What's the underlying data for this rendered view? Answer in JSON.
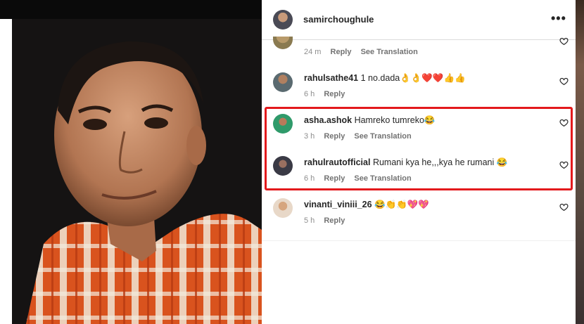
{
  "post": {
    "author": "samirchoughule",
    "more_label": "•••"
  },
  "partial_comment": {
    "time": "24 m",
    "reply_label": "Reply",
    "translate_label": "See Translation"
  },
  "comments": [
    {
      "username": "rahulsathe41",
      "text": "1 no.dada👌👌❤️❤️👍👍",
      "time": "6 h",
      "reply_label": "Reply",
      "translate_label": ""
    },
    {
      "username": "asha.ashok",
      "text": "Hamreko tumreko😂",
      "time": "3 h",
      "reply_label": "Reply",
      "translate_label": "See Translation"
    },
    {
      "username": "rahulrautofficial",
      "text": "Rumani kya he,,,kya he rumani 😂",
      "time": "6 h",
      "reply_label": "Reply",
      "translate_label": "See Translation"
    },
    {
      "username": "vinanti_viniii_26",
      "text": "😂👏👏💖💖",
      "time": "5 h",
      "reply_label": "Reply",
      "translate_label": ""
    }
  ],
  "highlight_color": "#e3191c",
  "icons": {
    "heart": "heart-outline-icon",
    "more": "more-horizontal-icon"
  }
}
